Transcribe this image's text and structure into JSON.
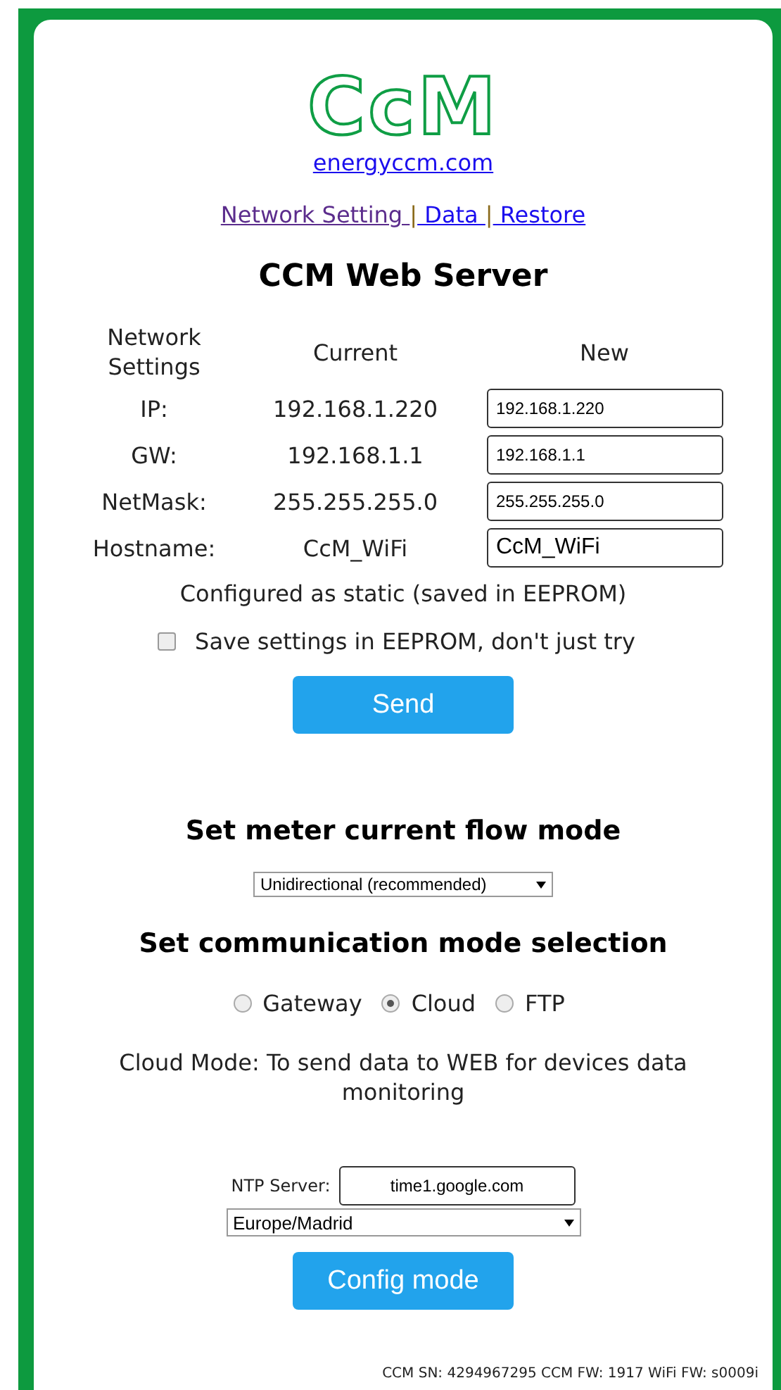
{
  "logo": "CcM",
  "site_link": "energyccm.com",
  "nav_separator": "|",
  "nav": [
    {
      "label": "Network Setting ",
      "visited": true
    },
    {
      "label": " Data ",
      "visited": false
    },
    {
      "label": " Restore",
      "visited": false
    }
  ],
  "title": "CCM Web Server",
  "network": {
    "headers": [
      "Network Settings",
      "Current",
      "New"
    ],
    "rows": [
      {
        "label": "IP:",
        "current": "192.168.1.220",
        "new": "192.168.1.220"
      },
      {
        "label": "GW:",
        "current": "192.168.1.1",
        "new": "192.168.1.1"
      },
      {
        "label": "NetMask:",
        "current": "255.255.255.0",
        "new": "255.255.255.0"
      },
      {
        "label": "Hostname:",
        "current": "CcM_WiFi",
        "new": "CcM_WiFi"
      }
    ],
    "status": "Configured as static (saved in EEPROM)",
    "save_option": {
      "label": "Save settings in EEPROM, don't just try",
      "checked": false
    },
    "button": "Send"
  },
  "flow": {
    "title": "Set meter current flow mode",
    "value": "Unidirectional (recommended)"
  },
  "comm": {
    "title": "Set communication mode selection",
    "options": [
      {
        "label": "Gateway",
        "selected": false
      },
      {
        "label": "Cloud",
        "selected": true
      },
      {
        "label": "FTP",
        "selected": false
      }
    ],
    "description": "Cloud Mode: To send data to WEB for devices data monitoring",
    "ntp_label": "NTP Server:",
    "ntp_value": "time1.google.com",
    "timezone": "Europe/Madrid",
    "button": "Config mode"
  },
  "footer": "CCM SN: 4294967295 CCM FW: 1917 WiFi FW: s0009i"
}
